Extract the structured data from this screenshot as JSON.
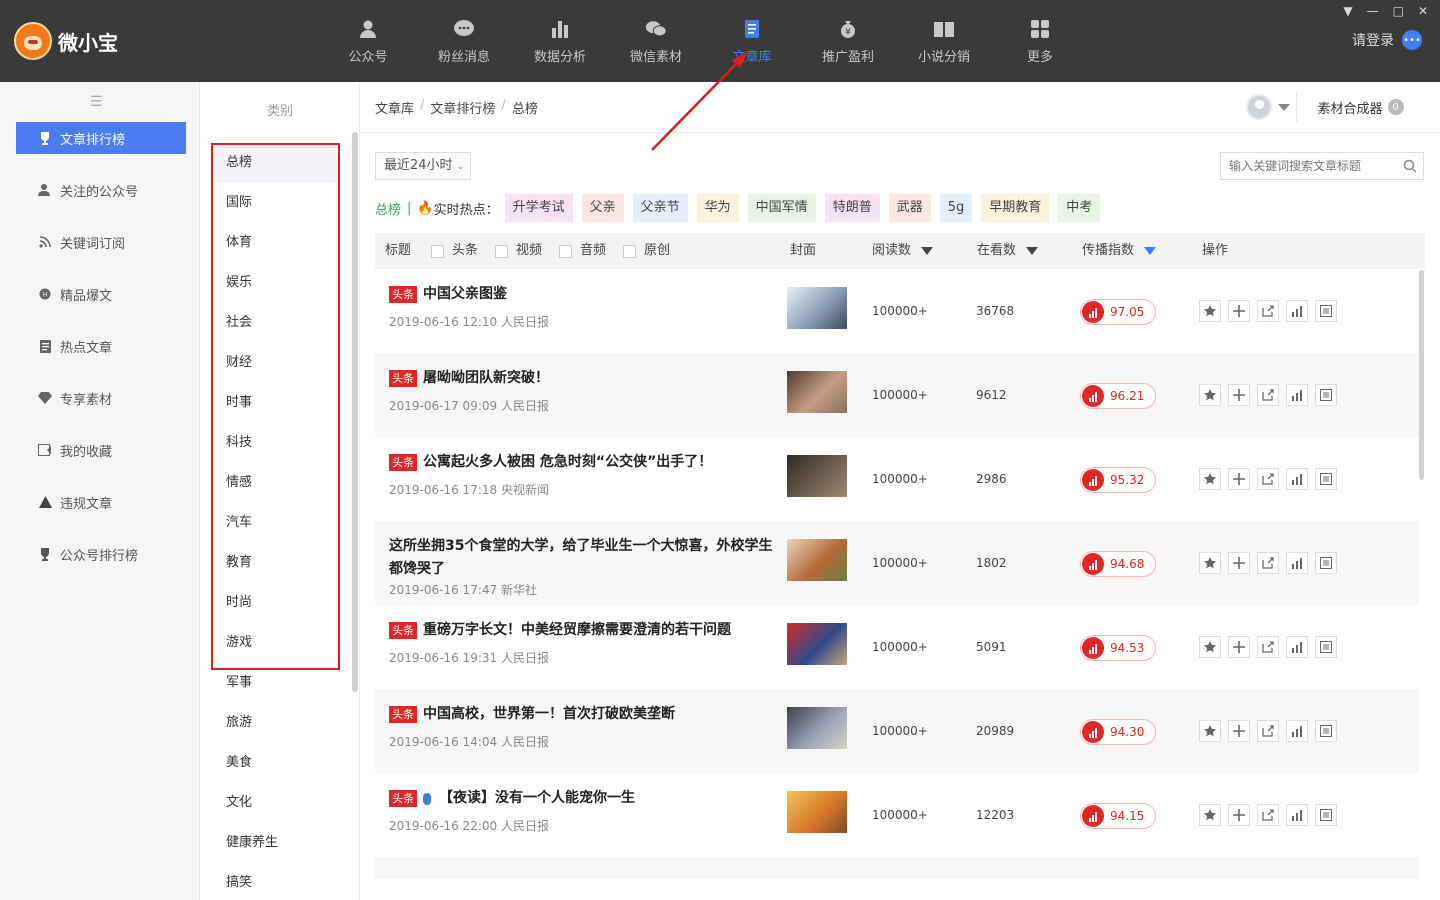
{
  "app": {
    "name": "微小宝",
    "login": "请登录"
  },
  "nav": [
    {
      "label": "公众号",
      "icon": "user-icon"
    },
    {
      "label": "粉丝消息",
      "icon": "chat-icon"
    },
    {
      "label": "数据分析",
      "icon": "bar-chart-icon"
    },
    {
      "label": "微信素材",
      "icon": "wechat-icon"
    },
    {
      "label": "文章库",
      "icon": "document-icon",
      "active": true
    },
    {
      "label": "推广盈利",
      "icon": "money-bag-icon"
    },
    {
      "label": "小说分销",
      "icon": "book-icon"
    },
    {
      "label": "更多",
      "icon": "grid-icon"
    }
  ],
  "sidebar": {
    "items": [
      {
        "label": "文章排行榜",
        "icon": "trophy-icon",
        "active": true
      },
      {
        "label": "关注的公众号",
        "icon": "user-follow-icon"
      },
      {
        "label": "关键词订阅",
        "icon": "rss-icon"
      },
      {
        "label": "精品爆文",
        "icon": "hot-icon"
      },
      {
        "label": "热点文章",
        "icon": "file-icon"
      },
      {
        "label": "专享素材",
        "icon": "diamond-icon"
      },
      {
        "label": "我的收藏",
        "icon": "favorite-icon"
      },
      {
        "label": "违规文章",
        "icon": "warning-icon"
      },
      {
        "label": "公众号排行榜",
        "icon": "cup-icon"
      }
    ]
  },
  "categories": {
    "header": "类别",
    "items": [
      "总榜",
      "国际",
      "体育",
      "娱乐",
      "社会",
      "财经",
      "时事",
      "科技",
      "情感",
      "汽车",
      "教育",
      "时尚",
      "游戏",
      "军事",
      "旅游",
      "美食",
      "文化",
      "健康养生",
      "搞笑"
    ]
  },
  "breadcrumb": [
    "文章库",
    "文章排行榜",
    "总榜"
  ],
  "toolbar": {
    "compose_label": "素材合成器",
    "compose_count": "0",
    "time_filter": "最近24小时",
    "search_placeholder": "输入关键词搜索文章标题"
  },
  "hot": {
    "total_label": "总榜",
    "realtime_label": "实时热点：",
    "tags": [
      {
        "label": "升学考试",
        "bg": "#f6e2f3"
      },
      {
        "label": "父亲",
        "bg": "#fbe7df"
      },
      {
        "label": "父亲节",
        "bg": "#e3eefb"
      },
      {
        "label": "华为",
        "bg": "#fbf1df"
      },
      {
        "label": "中国军情",
        "bg": "#e6f4e4"
      },
      {
        "label": "特朗普",
        "bg": "#f6e2f3"
      },
      {
        "label": "武器",
        "bg": "#fbe7df"
      },
      {
        "label": "5g",
        "bg": "#e3eefb"
      },
      {
        "label": "早期教育",
        "bg": "#fbf1df"
      },
      {
        "label": "中考",
        "bg": "#e6f4e4"
      }
    ]
  },
  "table": {
    "headers": {
      "title": "标题",
      "filters": [
        "头条",
        "视频",
        "音频",
        "原创"
      ],
      "cover": "封面",
      "reads": "阅读数",
      "watching": "在看数",
      "spread": "传播指数",
      "ops": "操作"
    },
    "rows": [
      {
        "badge": "头条",
        "title": "中国父亲图鉴",
        "meta": "2019-06-16 12:10 人民日报",
        "reads": "100000+",
        "watching": "36768",
        "score": "97.05",
        "thumb": [
          "#e9eef4",
          "#8a9fb8",
          "#3b4a5c"
        ]
      },
      {
        "badge": "头条",
        "title": "屠呦呦团队新突破！",
        "meta": "2019-06-17 09:09 人民日报",
        "reads": "100000+",
        "watching": "9612",
        "score": "96.21",
        "thumb": [
          "#4b3a32",
          "#c59d82",
          "#8a6f5d"
        ]
      },
      {
        "badge": "头条",
        "title": "公寓起火多人被困 危急时刻“公交侠”出手了！",
        "meta": "2019-06-16 17:18 央视新闻",
        "reads": "100000+",
        "watching": "2986",
        "score": "95.32",
        "thumb": [
          "#2e2a26",
          "#6d5e4e",
          "#a08b70"
        ]
      },
      {
        "badge": "",
        "title": "这所坐拥35个食堂的大学，给了毕业生一个大惊喜，外校学生都馋哭了",
        "meta": "2019-06-16 17:47 新华社",
        "reads": "100000+",
        "watching": "1802",
        "score": "94.68",
        "thumb": [
          "#e8d8c0",
          "#b56a3a",
          "#6b7d3c"
        ]
      },
      {
        "badge": "头条",
        "title": "重磅万字长文！中美经贸摩擦需要澄清的若干问题",
        "meta": "2019-06-16 19:31 人民日报",
        "reads": "100000+",
        "watching": "5091",
        "score": "94.53",
        "thumb": [
          "#d42a2a",
          "#2f4a8c",
          "#c9a77a"
        ]
      },
      {
        "badge": "头条",
        "title": "中国高校，世界第一！首次打破欧美垄断",
        "meta": "2019-06-16 14:04 人民日报",
        "reads": "100000+",
        "watching": "20989",
        "score": "94.30",
        "thumb": [
          "#3c3f4a",
          "#9aa3b5",
          "#d8d2c8"
        ]
      },
      {
        "badge": "头条",
        "title": "【夜读】没有一个人能宠你一生",
        "meta": "2019-06-16 22:00 人民日报",
        "reads": "100000+",
        "watching": "12203",
        "score": "94.15",
        "thumb": [
          "#f2c25a",
          "#d97a2a",
          "#7a4a2a"
        ],
        "audio": true
      }
    ]
  },
  "colors": {
    "accent": "#4a7cf1",
    "danger": "#e02626",
    "topbar": "#3a3a3a"
  }
}
